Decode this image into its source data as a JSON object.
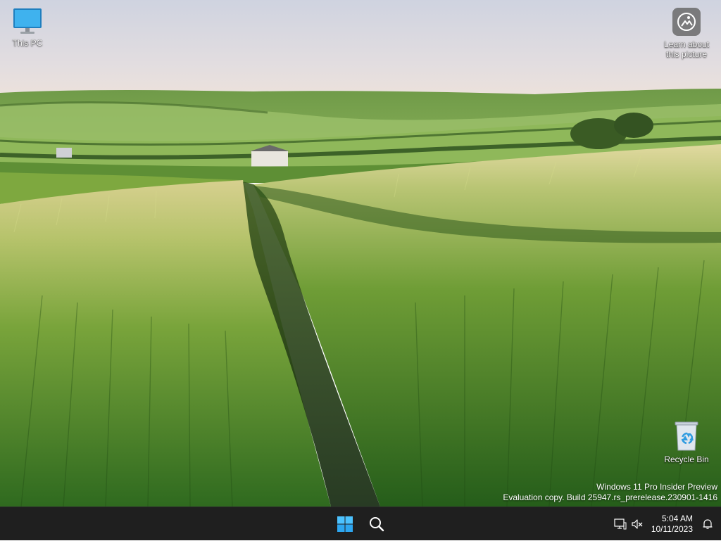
{
  "desktop": {
    "icons": [
      {
        "name": "this-pc",
        "label": "This PC",
        "icon": "monitor-icon"
      },
      {
        "name": "learn-about-picture",
        "label": "Learn about this picture",
        "icon": "camera-location-icon"
      },
      {
        "name": "recycle-bin",
        "label": "Recycle Bin",
        "icon": "recycle-bin-icon"
      }
    ],
    "watermark": {
      "line1": "Windows 11 Pro Insider Preview",
      "line2": "Evaluation copy. Build 25947.rs_prerelease.230901-1416"
    }
  },
  "taskbar": {
    "start_icon": "windows-logo-icon",
    "search_icon": "search-icon",
    "tray": {
      "network_icon": "network-icon",
      "volume_icon": "volume-muted-icon",
      "time": "5:04 AM",
      "date": "10/11/2023",
      "notification_icon": "bell-icon"
    }
  },
  "colors": {
    "taskbar_bg": "#1f1f1f",
    "windows_logo": "#4cc2ff",
    "monitor_screen": "#36a9e8"
  }
}
